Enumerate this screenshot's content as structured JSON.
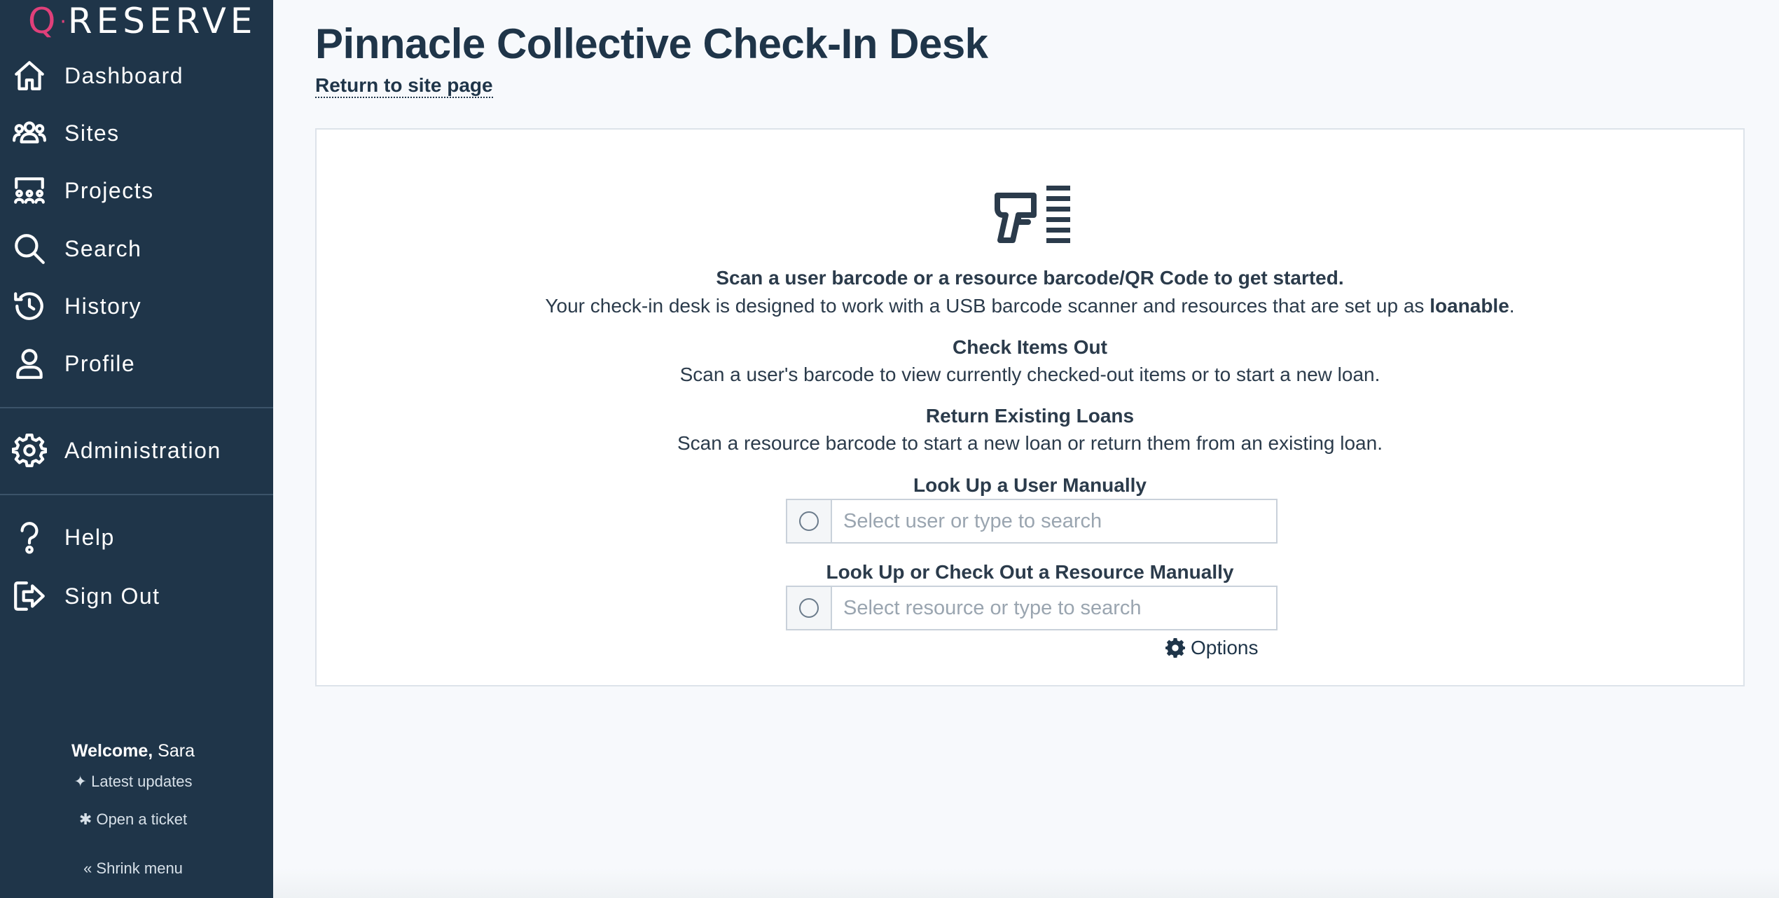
{
  "brand": {
    "q": "Q",
    "dot": "·",
    "name": "RESERVE"
  },
  "sidebar": {
    "items": [
      {
        "label": "Dashboard",
        "icon": "home-icon"
      },
      {
        "label": "Sites",
        "icon": "users-icon"
      },
      {
        "label": "Projects",
        "icon": "projects-icon"
      },
      {
        "label": "Search",
        "icon": "search-icon"
      },
      {
        "label": "History",
        "icon": "history-icon"
      },
      {
        "label": "Profile",
        "icon": "user-icon"
      },
      {
        "label": "Administration",
        "icon": "gear-icon"
      },
      {
        "label": "Help",
        "icon": "help-icon"
      },
      {
        "label": "Sign Out",
        "icon": "sign-out-icon"
      }
    ],
    "welcome_prefix": "Welcome,",
    "welcome_name": " Sara",
    "latest_updates": "Latest updates",
    "open_ticket": "Open a ticket",
    "shrink_menu": "« Shrink menu"
  },
  "page": {
    "title": "Pinnacle Collective Check-In Desk",
    "return_link": "Return to site page"
  },
  "card": {
    "intro_heading": "Scan a user barcode or a resource barcode/QR Code to get started.",
    "intro_text": "Your check-in desk is designed to work with a USB barcode scanner and resources that are set up as ",
    "intro_bold": "loanable",
    "intro_end": ".",
    "checkout_heading": "Check Items Out",
    "checkout_text": "Scan a user's barcode to view currently checked-out items or to start a new loan.",
    "return_heading": "Return Existing Loans",
    "return_text": "Scan a resource barcode to start a new loan or return them from an existing loan.",
    "user_lookup_heading": "Look Up a User Manually",
    "user_lookup_placeholder": "Select user or type to search",
    "resource_lookup_heading": "Look Up or Check Out a Resource Manually",
    "resource_lookup_placeholder": "Select resource or type to search",
    "options_label": "Options"
  }
}
